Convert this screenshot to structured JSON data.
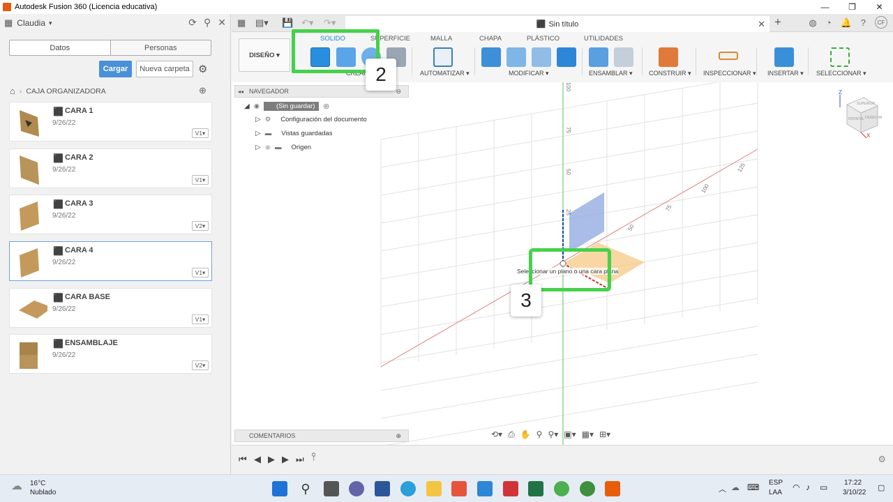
{
  "window": {
    "title": "Autodesk Fusion 360 (Licencia educativa)",
    "controls": [
      "—",
      "❐",
      "✕"
    ]
  },
  "left_panel": {
    "user": "Claudia",
    "tabs": [
      {
        "label": "Datos"
      },
      {
        "label": "Personas"
      }
    ],
    "upload_label": "Cargar",
    "new_folder_label": "Nueva carpeta",
    "breadcrumb": "CAJA ORGANIZADORA",
    "files": [
      {
        "name": "CARA 1",
        "date": "9/26/22",
        "version": "V1▾"
      },
      {
        "name": "CARA 2",
        "date": "9/26/22",
        "version": "V1▾"
      },
      {
        "name": "CARA 3",
        "date": "9/26/22",
        "version": "V2▾"
      },
      {
        "name": "CARA 4",
        "date": "9/26/22",
        "version": "V1▾"
      },
      {
        "name": "CARA BASE",
        "date": "9/26/22",
        "version": "V1▾"
      },
      {
        "name": "ENSAMBLAJE",
        "date": "9/26/22",
        "version": "V2▾"
      }
    ]
  },
  "document_tab": {
    "title": "Sin título"
  },
  "ribbon": {
    "workspace": "DISEÑO ▾",
    "tabs": [
      "SOLIDO",
      "SUPERFICIE",
      "MALLA",
      "CHAPA",
      "PLÁSTICO",
      "UTILIDADES"
    ],
    "groups": [
      "CREAR ▾",
      "AUTOMATIZAR ▾",
      "MODIFICAR ▾",
      "ENSAMBLAR ▾",
      "CONSTRUIR ▾",
      "INSPECCIONAR ▾",
      "INSERTAR ▾",
      "SELECCIONAR ▾"
    ]
  },
  "browser": {
    "title": "NAVEGADOR",
    "root": "(Sin guardar)",
    "items": [
      "Configuración del documento",
      "Vistas guardadas",
      "Origen"
    ]
  },
  "comments_label": "COMENTARIOS",
  "viewport": {
    "tooltip": "Seleccionar un plano o una cara plana",
    "axis_ticks_green": [
      "100",
      "75",
      "50",
      "25"
    ],
    "axis_ticks_red": [
      "125",
      "100",
      "75",
      "50"
    ],
    "viewcube_labels": [
      "SUPERIOR",
      "FRONTAL",
      "DERECHA"
    ]
  },
  "annotations": [
    {
      "label": "2"
    },
    {
      "label": "3"
    }
  ],
  "taskbar": {
    "temperature": "16°C",
    "weather": "Nublado",
    "lang1": "ESP",
    "lang2": "LAA",
    "time": "17:22",
    "date": "3/10/22"
  },
  "colors": {
    "accent": "#1a84d6",
    "annotation": "#44d24a",
    "upload_button": "#4a90d9"
  }
}
